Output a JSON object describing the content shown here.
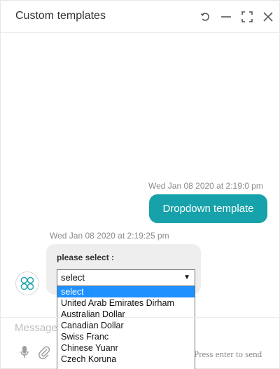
{
  "window": {
    "title": "Custom templates",
    "controls": [
      "refresh-icon",
      "minimize-icon",
      "maximize-icon",
      "close-icon"
    ]
  },
  "messages": {
    "outgoing": {
      "timestamp": "Wed Jan 08 2020 at 2:19:0 pm",
      "text": "Dropdown template"
    },
    "incoming": {
      "timestamp": "Wed Jan 08 2020 at 2:19:25 pm",
      "prompt": "please select :",
      "select_value": "select",
      "options": [
        "select",
        "United Arab Emirates Dirham",
        "Australian Dollar",
        "Canadian Dollar",
        "Swiss Franc",
        "Chinese Yuanr",
        "Czech Koruna"
      ],
      "highlighted_option": 0
    }
  },
  "composer": {
    "placeholder": "Message",
    "hint": "Press enter to send",
    "tools": [
      "microphone-icon",
      "paperclip-icon"
    ]
  },
  "colors": {
    "accent": "#17a2ab",
    "highlight": "#1e90ff"
  }
}
